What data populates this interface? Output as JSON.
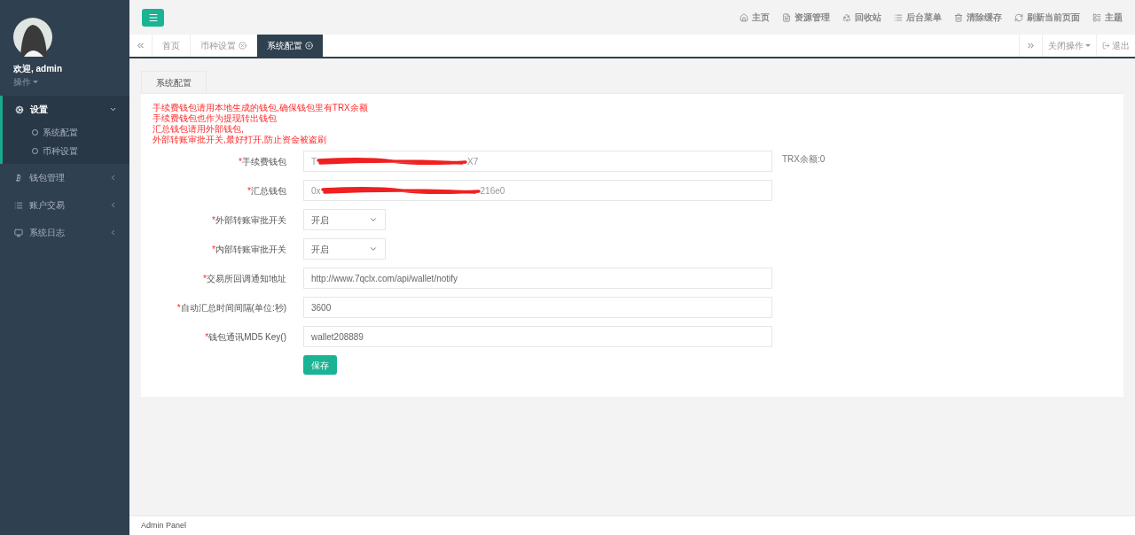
{
  "sidebar": {
    "welcome": "欢迎, admin",
    "user_menu": "操作",
    "menu": [
      {
        "kind": "settings",
        "label": "设置",
        "expanded": true,
        "selected": true,
        "children": [
          {
            "label": "系统配置"
          },
          {
            "label": "币种设置"
          }
        ]
      },
      {
        "kind": "bitcoin",
        "label": "钱包管理",
        "expanded": false,
        "selected": false
      },
      {
        "kind": "list",
        "label": "账户交易",
        "expanded": false,
        "selected": false
      },
      {
        "kind": "monitor",
        "label": "系统日志",
        "expanded": false,
        "selected": false
      }
    ]
  },
  "topbar": {
    "links": [
      {
        "kind": "home",
        "label": "主页"
      },
      {
        "kind": "file",
        "label": "资源管理"
      },
      {
        "kind": "recycle",
        "label": "回收站"
      },
      {
        "kind": "list",
        "label": "后台菜单"
      },
      {
        "kind": "trash",
        "label": "清除缓存"
      },
      {
        "kind": "refresh",
        "label": "刷新当前页面"
      },
      {
        "kind": "theme",
        "label": "主题"
      }
    ]
  },
  "page_tabs": [
    {
      "label": "首页",
      "closable": false,
      "selected": false
    },
    {
      "label": "币种设置",
      "closable": true,
      "selected": false
    },
    {
      "label": "系统配置",
      "closable": true,
      "selected": true
    }
  ],
  "tab_actions": {
    "close_ops": "关闭操作",
    "logout": "退出"
  },
  "panel": {
    "tab": "系统配置",
    "notes": [
      "手续费钱包请用本地生成的钱包,确保钱包里有TRX余额",
      "手续费钱包也作为提现转出钱包",
      "汇总钱包请用外部钱包,",
      "外部转账审批开关,最好打开,防止资金被盗刷"
    ],
    "fields": [
      {
        "kind": "redacted",
        "mark": "*",
        "label": "手续费钱包",
        "prefix": "T",
        "suffix": "X7",
        "aside": "TRX余额:0"
      },
      {
        "kind": "redacted",
        "mark": "*",
        "label": "汇总钱包",
        "prefix": "0x",
        "suffix": "216e0"
      },
      {
        "kind": "select",
        "mark": "*",
        "label": "外部转账审批开关",
        "value": "开启"
      },
      {
        "kind": "select",
        "mark": "*",
        "label": "内部转账审批开关",
        "value": "开启"
      },
      {
        "kind": "text",
        "mark": "*",
        "label": "交易所回调通知地址",
        "value": "http://www.7qclx.com/api/wallet/notify"
      },
      {
        "kind": "text",
        "mark": "*",
        "label": "自动汇总时间间隔(单位:秒)",
        "value": "3600"
      },
      {
        "kind": "text",
        "mark": "*",
        "label": "钱包通讯MD5 Key()",
        "value": "wallet208889"
      }
    ],
    "save": "保存"
  },
  "footer": "Admin Panel"
}
